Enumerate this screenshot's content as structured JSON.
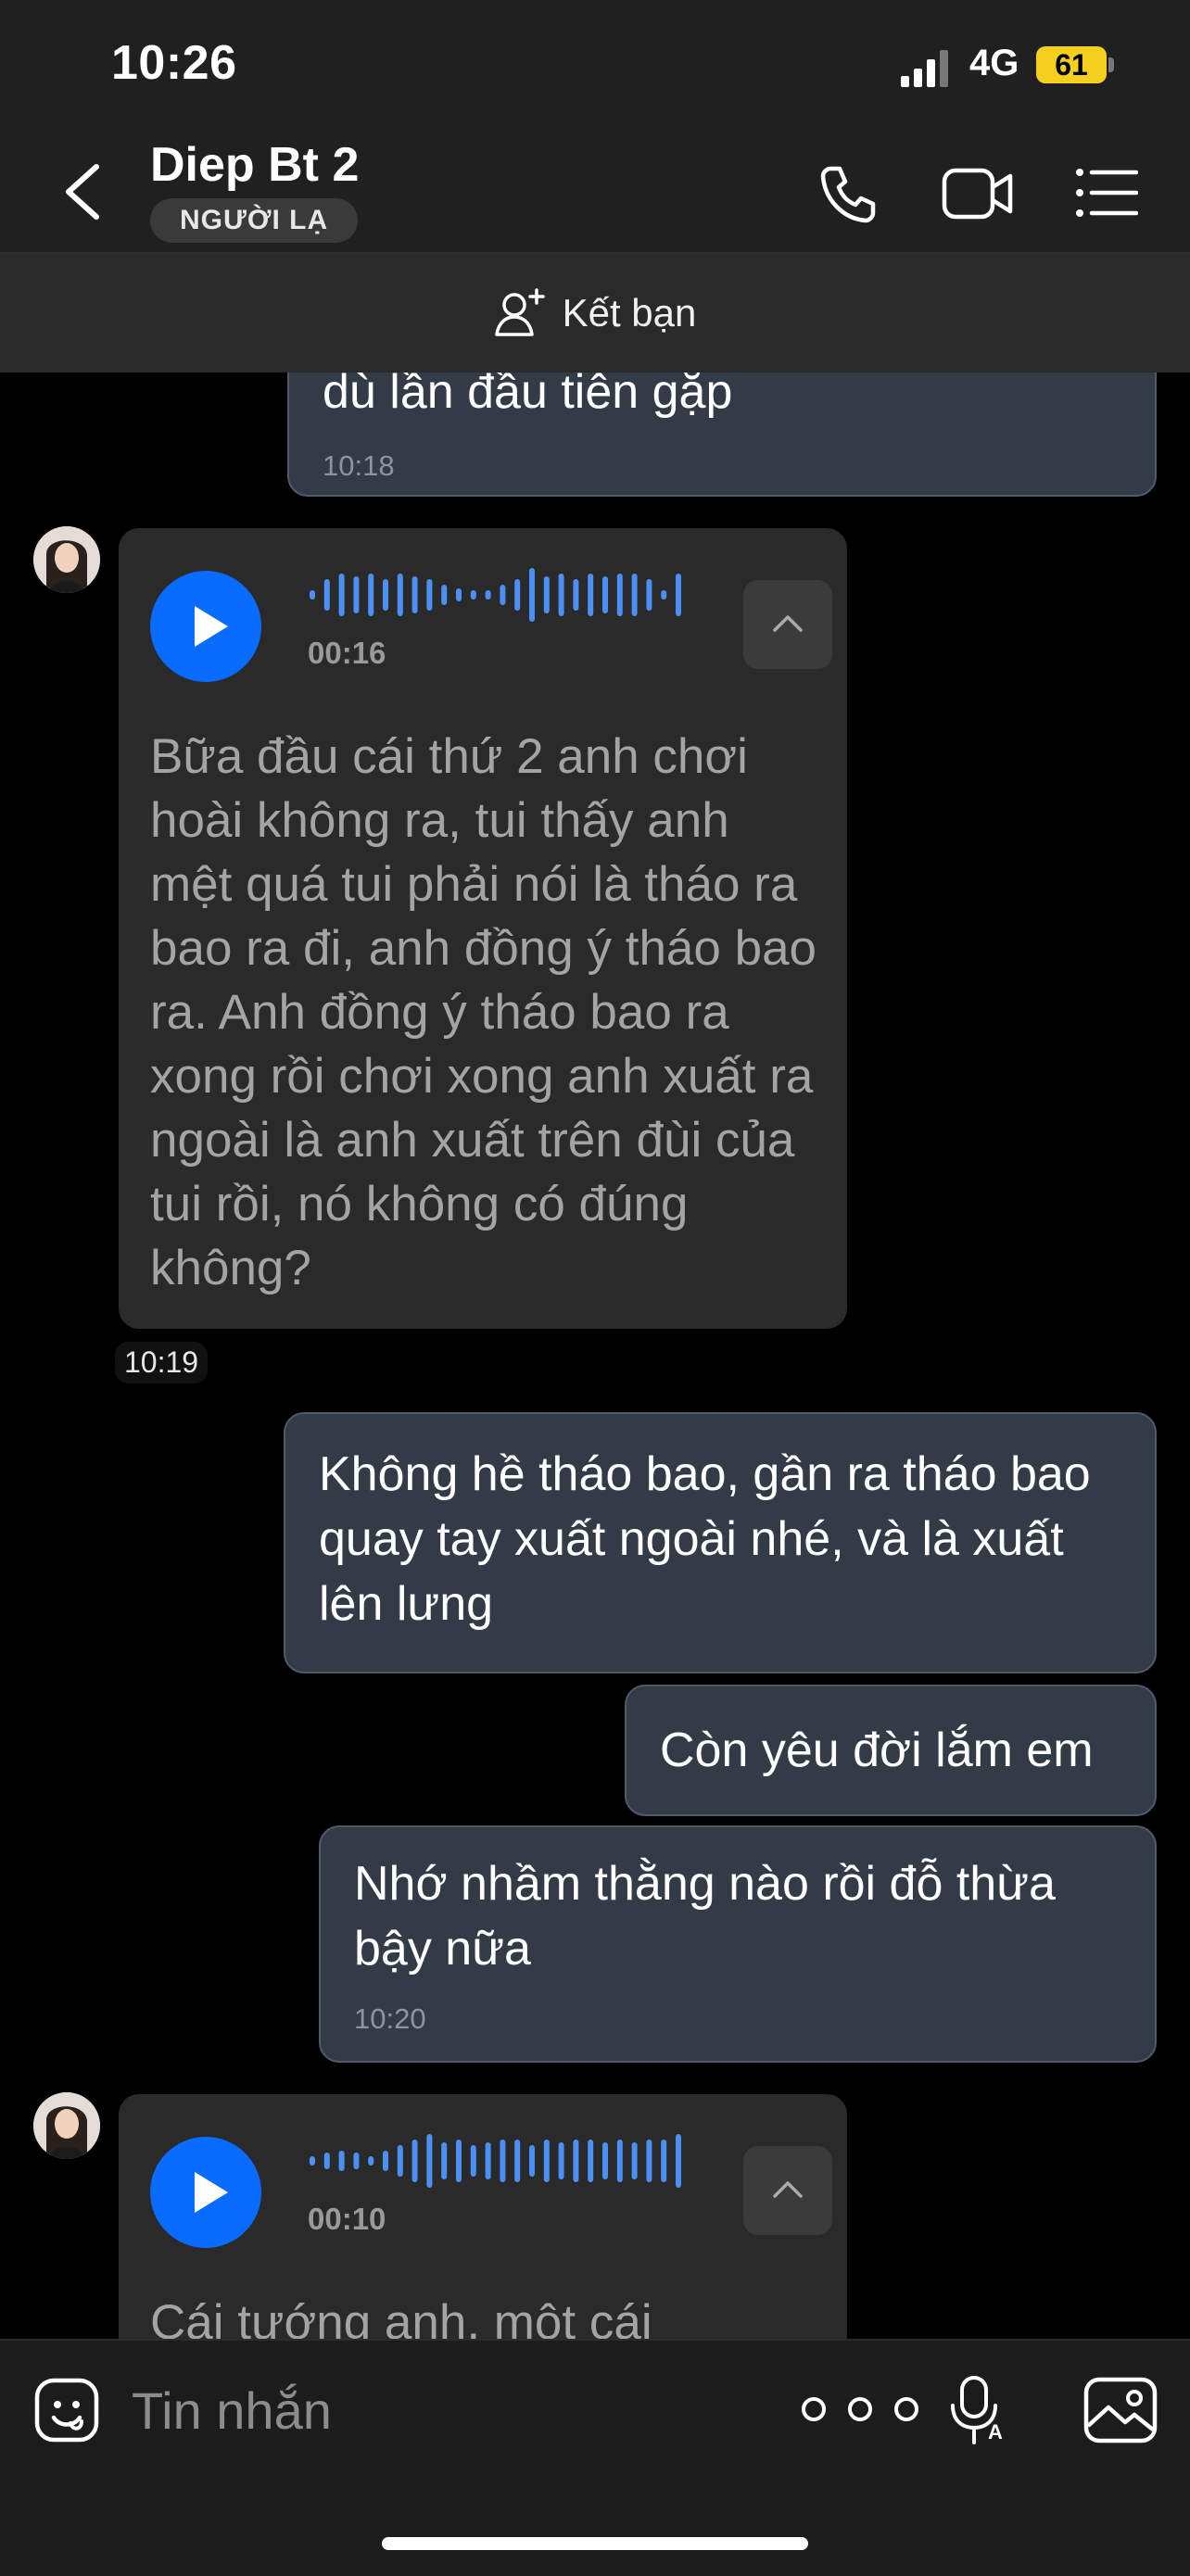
{
  "status_bar": {
    "time": "10:26",
    "network": "4G",
    "battery": "61"
  },
  "header": {
    "contact_name": "Diep Bt 2",
    "badge": "NGƯỜI LẠ"
  },
  "add_friend": {
    "label": "Kết bạn"
  },
  "messages": {
    "m1": {
      "text": "dù lần đầu tiên gặp",
      "time": "10:18"
    },
    "v1": {
      "duration": "00:16",
      "transcript": "Bữa đầu cái thứ 2 anh chơi hoài không ra, tui thấy anh mệt quá tui phải nói là tháo ra bao ra đi, anh đồng ý tháo bao ra. Anh đồng ý tháo bao ra xong rồi chơi xong anh xuất ra ngoài là anh xuất trên đùi của tui rồi, nó không có đúng không?",
      "time": "10:19"
    },
    "m2": {
      "text": "Không hề tháo bao, gần ra tháo bao quay tay xuất ngoài nhé, và là xuất lên lưng"
    },
    "m3": {
      "text": "Còn yêu đời lắm em"
    },
    "m4": {
      "text": "Nhớ nhầm thằng nào rồi đỗ thừa bậy nữa",
      "time": "10:20"
    },
    "v2": {
      "duration": "00:10",
      "transcript": "Cái tướng anh, một cái"
    }
  },
  "composer": {
    "placeholder": "Tin nhắn"
  },
  "colors": {
    "accent": "#0a6cff",
    "waveform": "#4a90f5",
    "outgoing_bubble": "#333b47",
    "incoming_bubble": "#2a2a2a",
    "battery": "#f5cf1f"
  },
  "icons": [
    "back-icon",
    "phone-icon",
    "video-call-icon",
    "menu-icon",
    "add-friend-icon",
    "play-icon",
    "chevron-up-icon",
    "emoji-icon",
    "more-icon",
    "voice-to-text-icon",
    "image-icon"
  ]
}
